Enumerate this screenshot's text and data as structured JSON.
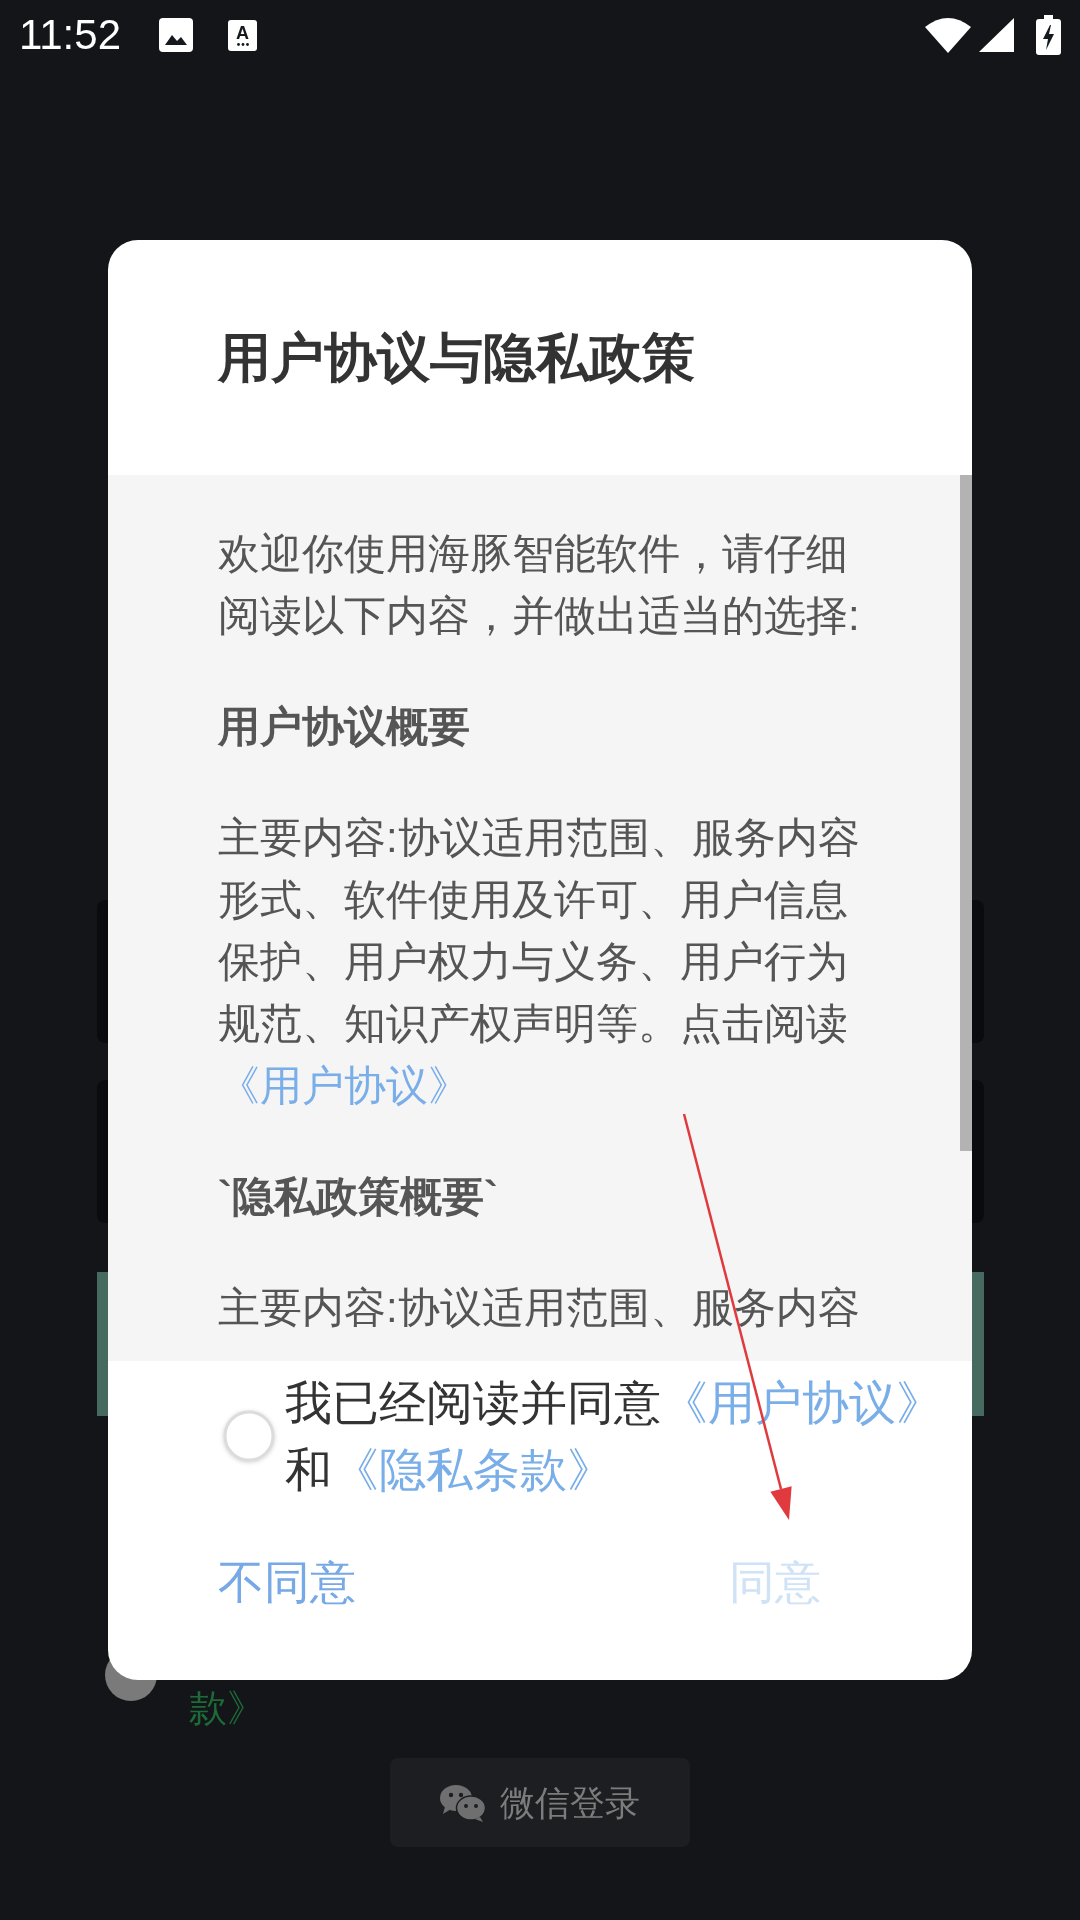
{
  "status_bar": {
    "time": "11:52",
    "notification_icon_letter": "A"
  },
  "background": {
    "consent_tail": "款》",
    "wechat_login_button": "微信登录"
  },
  "dialog": {
    "title": "用户协议与隐私政策",
    "content": [
      {
        "kind": "paragraph",
        "text": "欢迎你使用海豚智能软件，请仔细阅读以下内容，并做出适当的选择:"
      },
      {
        "kind": "heading",
        "text": "用户协议概要"
      },
      {
        "kind": "paragraph",
        "text": "主要内容:协议适用范围、服务内容形式、软件使用及许可、用户信息保护、用户权力与义务、用户行为规范、知识产权声明等。点击阅读",
        "link": "《用户协议》"
      },
      {
        "kind": "heading",
        "text": "`隐私政策概要`"
      },
      {
        "kind": "paragraph",
        "text": "主要内容:协议适用范围、服务内容"
      }
    ],
    "consent": {
      "checked": false,
      "parts": [
        {
          "kind": "text",
          "text": "我已经阅读并同意"
        },
        {
          "kind": "link",
          "text": "《用户协议》"
        },
        {
          "kind": "text",
          "text": "和"
        },
        {
          "kind": "link",
          "text": "《隐私条款》"
        }
      ]
    },
    "buttons": [
      {
        "label": "不同意",
        "disabled": false
      },
      {
        "label": "同意",
        "disabled": true
      }
    ]
  }
}
